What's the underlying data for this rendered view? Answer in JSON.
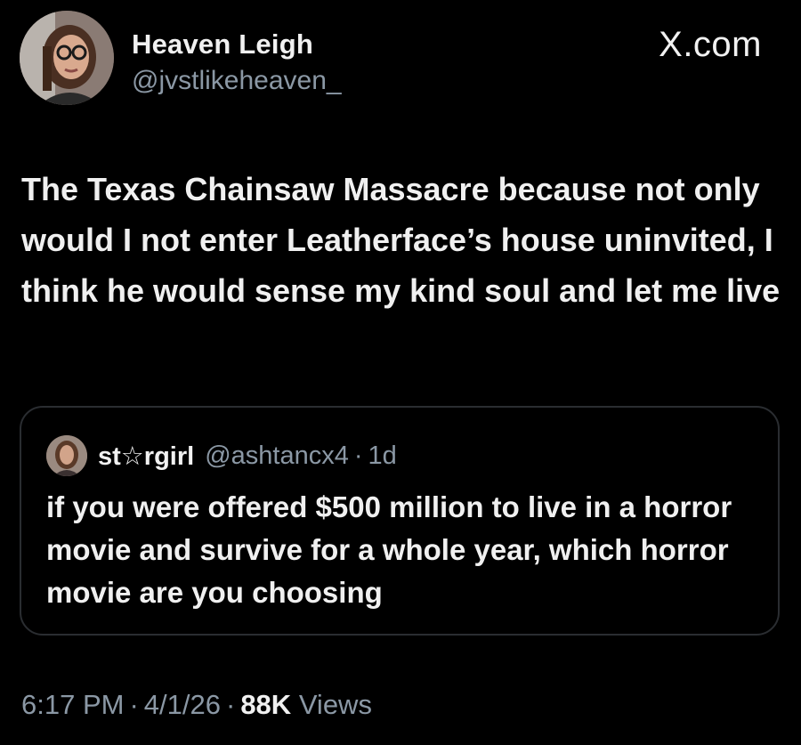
{
  "site_label": "X.com",
  "author": {
    "name": "Heaven Leigh",
    "handle": "@jvstlikeheaven_"
  },
  "tweet": {
    "text": "The Texas Chainsaw Massacre because not only would I not enter Leatherface’s house uninvited, I think he would sense my kind soul and let me live"
  },
  "quoted": {
    "name": "st☆rgirl",
    "handle": "@ashtancx4",
    "separator": "·",
    "time": "1d",
    "text": "if you were offered $500 million to live in a horror movie and survive for a whole year, which horror movie are you choosing"
  },
  "meta": {
    "time": "6:17 PM",
    "date": "4/1/26",
    "separator": "·",
    "views_count": "88K",
    "views_label": "Views"
  }
}
